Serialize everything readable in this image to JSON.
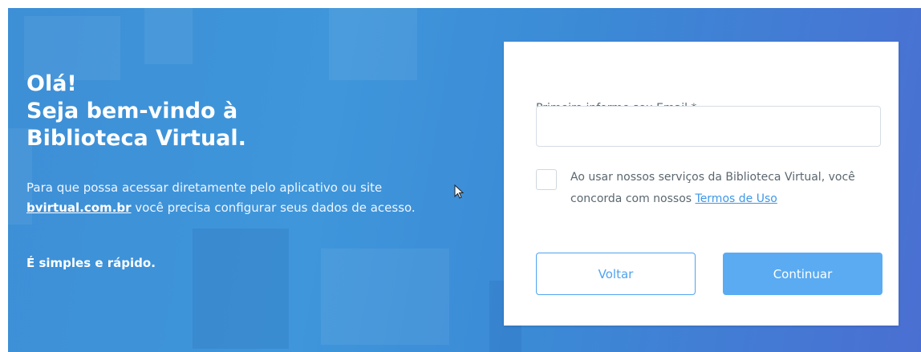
{
  "welcome": {
    "greeting": "Olá!",
    "line2": "Seja bem-vindo à",
    "line3": "Biblioteca Virtual.",
    "intro_before_link": "Para que possa acessar diretamente pelo aplicativo ou site ",
    "site_link": "bvirtual.com.br",
    "intro_after_link": " você precisa configurar seus dados de acesso.",
    "tagline": "É simples e rápido."
  },
  "form": {
    "email_label": "Primeiro informe seu Email *",
    "email_value": "",
    "terms_prefix": "Ao usar nossos serviços da Biblioteca Virtual, você concorda com nossos ",
    "terms_link": "Termos de Uso",
    "terms_checked": false,
    "back_label": "Voltar",
    "continue_label": "Continuar"
  },
  "colors": {
    "banner_blue": "#3f96da",
    "accent": "#4fa3ef",
    "continue_bg": "#5aabf2",
    "link": "#3e97e8"
  },
  "icons": [
    "mouse-cursor-icon"
  ]
}
